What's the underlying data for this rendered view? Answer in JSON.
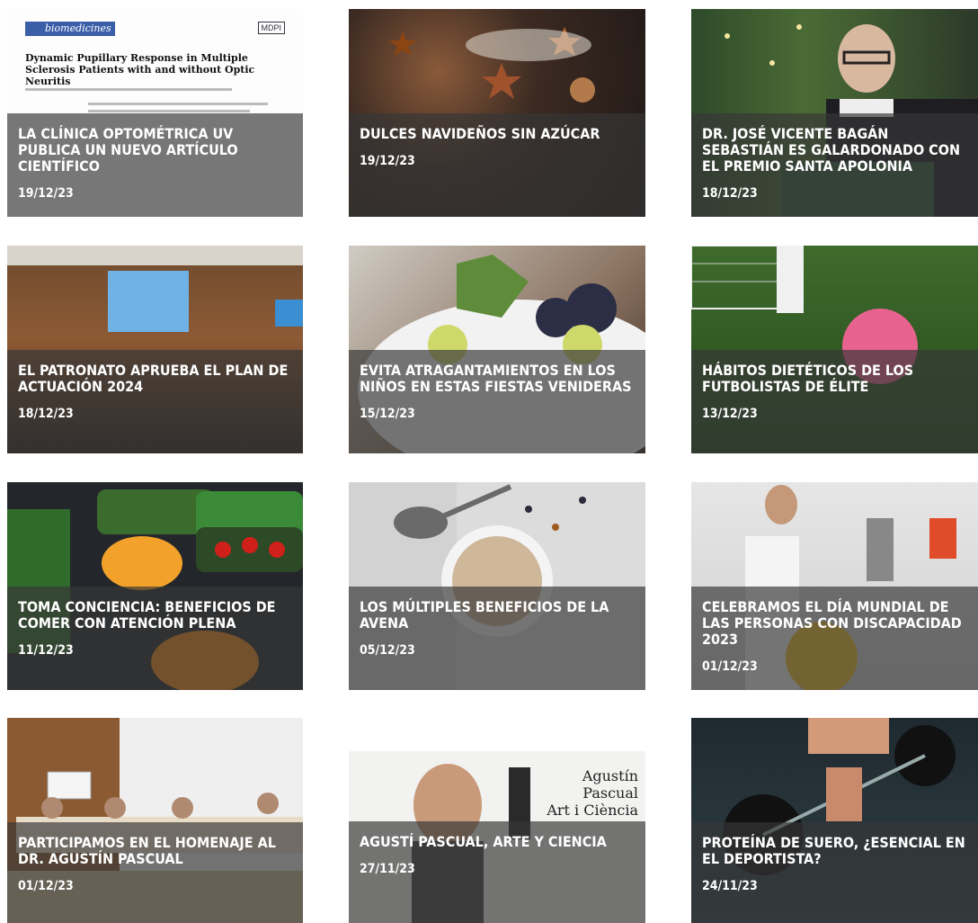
{
  "paper_preview": {
    "journal": "biomedicines",
    "publisher": "MDPI",
    "title": "Dynamic Pupillary Response in Multiple Sclerosis Patients with and without Optic Neuritis"
  },
  "news": [
    {
      "title": "La clínica optométrica UV publica un nuevo artículo científico",
      "date": "19/12/23"
    },
    {
      "title": "Dulces navideños sin azúcar",
      "date": "19/12/23"
    },
    {
      "title": "Dr. José Vicente Bagán Sebastián es galardonado con el premio Santa Apolonia",
      "date": "18/12/23"
    },
    {
      "title": "El Patronato aprueba el Plan de Actuación 2024",
      "date": "18/12/23"
    },
    {
      "title": "Evita atragantamientos en los niños en estas fiestas venideras",
      "date": "15/12/23"
    },
    {
      "title": "Hábitos dietéticos de los futbolistas de élite",
      "date": "13/12/23"
    },
    {
      "title": "Toma conciencia: beneficios de comer con atención plena",
      "date": "11/12/23"
    },
    {
      "title": "Los múltiples beneficios de la avena",
      "date": "05/12/23"
    },
    {
      "title": "Celebramos el Día Mundial de las Personas con Discapacidad 2023",
      "date": "01/12/23"
    },
    {
      "title": "Participamos en el homenaje al Dr. Agustín Pascual",
      "date": "01/12/23"
    },
    {
      "title": "Agustí Pascual, arte y ciencia",
      "date": "27/11/23"
    },
    {
      "title": "Proteína de suero, ¿esencial en el deportista?",
      "date": "24/11/23"
    }
  ],
  "art_poster": {
    "heading_line1": "Agustín Pascual",
    "heading_line2": "Art i Ciència"
  },
  "colors": {
    "overlay": "#373737",
    "text": "#ffffff",
    "page_bg": "#ffffff"
  }
}
